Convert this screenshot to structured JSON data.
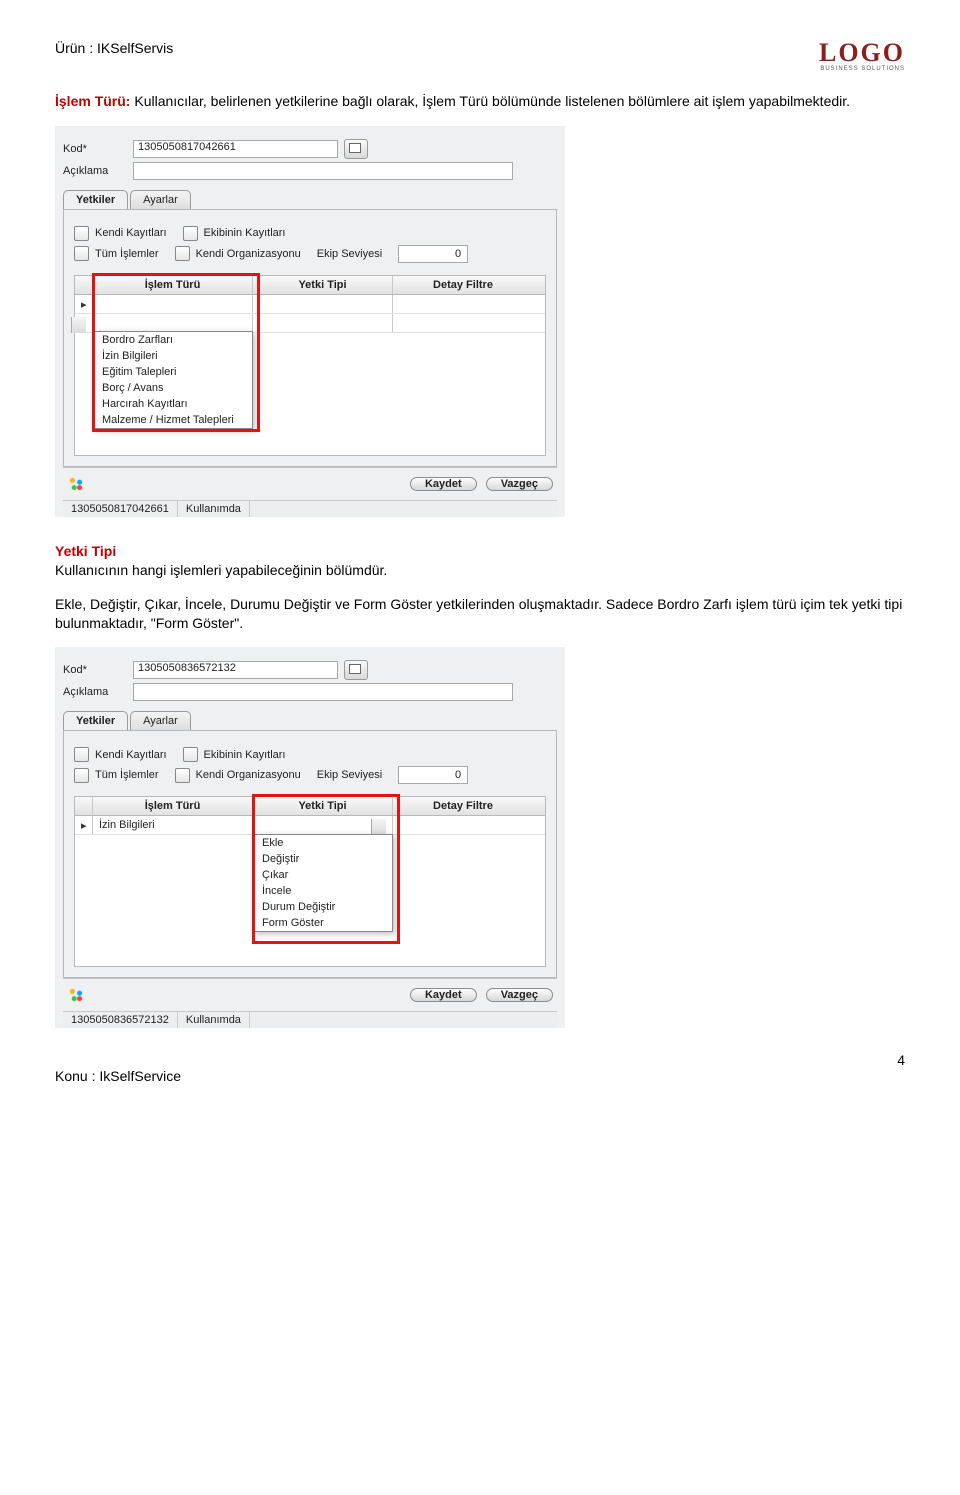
{
  "header": {
    "product_label": "Ürün    : IKSelfServis",
    "logo": "LOGO",
    "logo_sub": "BUSINESS SOLUTIONS"
  },
  "para1_lead": "İşlem Türü:",
  "para1_rest": " Kullanıcılar, belirlenen yetkilerine bağlı olarak, İşlem Türü bölümünde listelenen bölümlere ait işlem yapabilmektedir.",
  "card1": {
    "kod_lbl": "Kod*",
    "kod_val": "1305050817042661",
    "ack_lbl": "Açıklama",
    "tab_yetkiler": "Yetkiler",
    "tab_ayarlar": "Ayarlar",
    "chk_kendi": "Kendi Kayıtları",
    "chk_ekip": "Ekibinin Kayıtları",
    "chk_tum": "Tüm İşlemler",
    "chk_org": "Kendi Organizasyonu",
    "lbl_ekip_sev": "Ekip Seviyesi",
    "ekip_sev_val": "0",
    "col1": "İşlem Türü",
    "col2": "Yetki Tipi",
    "col3": "Detay Filtre",
    "dd_items": [
      "Bordro Zarfları",
      "İzin Bilgileri",
      "Eğitim Talepleri",
      "Borç / Avans",
      "Harcırah Kayıtları",
      "Malzeme / Hizmet Talepleri"
    ],
    "btn_save": "Kaydet",
    "btn_cancel": "Vazgeç",
    "status_code": "1305050817042661",
    "status_text": "Kullanımda"
  },
  "yetki_heading": "Yetki Tipi",
  "yetki_line": "Kullanıcının hangi işlemleri yapabileceğinin bölümdür.",
  "para2": "Ekle, Değiştir, Çıkar, İncele, Durumu Değiştir ve Form Göster yetkilerinden oluşmaktadır. Sadece Bordro Zarfı işlem türü içim tek yetki tipi bulunmaktadır, \"Form Göster\".",
  "card2": {
    "kod_val": "1305050836572132",
    "row1_val": "İzin Bilgileri",
    "dd_items": [
      "Ekle",
      "Değiştir",
      "Çıkar",
      "İncele",
      "Durum Değiştir",
      "Form Göster"
    ],
    "status_code": "1305050836572132",
    "status_text": "Kullanımda"
  },
  "footer": {
    "topic": "Konu : IkSelfService",
    "page": "4"
  }
}
